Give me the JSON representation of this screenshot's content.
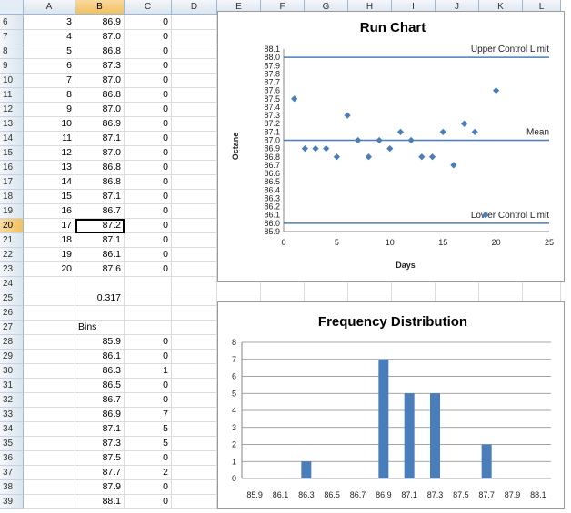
{
  "sheet": {
    "columns": [
      "A",
      "B",
      "C",
      "D",
      "E",
      "F",
      "G",
      "H",
      "I",
      "J",
      "K",
      "L"
    ],
    "selected_column": "B",
    "active_cell": "B20",
    "rows": [
      {
        "row": "6",
        "a": "3",
        "b": "86.9",
        "c": "0"
      },
      {
        "row": "7",
        "a": "4",
        "b": "87.0",
        "c": "0"
      },
      {
        "row": "8",
        "a": "5",
        "b": "86.8",
        "c": "0"
      },
      {
        "row": "9",
        "a": "6",
        "b": "87.3",
        "c": "0"
      },
      {
        "row": "10",
        "a": "7",
        "b": "87.0",
        "c": "0"
      },
      {
        "row": "11",
        "a": "8",
        "b": "86.8",
        "c": "0"
      },
      {
        "row": "12",
        "a": "9",
        "b": "87.0",
        "c": "0"
      },
      {
        "row": "13",
        "a": "10",
        "b": "86.9",
        "c": "0"
      },
      {
        "row": "14",
        "a": "11",
        "b": "87.1",
        "c": "0"
      },
      {
        "row": "15",
        "a": "12",
        "b": "87.0",
        "c": "0"
      },
      {
        "row": "16",
        "a": "13",
        "b": "86.8",
        "c": "0"
      },
      {
        "row": "17",
        "a": "14",
        "b": "86.8",
        "c": "0"
      },
      {
        "row": "18",
        "a": "15",
        "b": "87.1",
        "c": "0"
      },
      {
        "row": "19",
        "a": "16",
        "b": "86.7",
        "c": "0"
      },
      {
        "row": "20",
        "a": "17",
        "b": "87.2",
        "c": "0"
      },
      {
        "row": "21",
        "a": "18",
        "b": "87.1",
        "c": "0"
      },
      {
        "row": "22",
        "a": "19",
        "b": "86.1",
        "c": "0"
      },
      {
        "row": "23",
        "a": "20",
        "b": "87.6",
        "c": "0"
      },
      {
        "row": "24",
        "a": "",
        "b": "",
        "c": ""
      },
      {
        "row": "25",
        "a": "",
        "b": "0.317",
        "c": ""
      },
      {
        "row": "26",
        "a": "",
        "b": "",
        "c": ""
      },
      {
        "row": "27",
        "a": "",
        "b": "Bins",
        "c": ""
      },
      {
        "row": "28",
        "a": "",
        "b": "85.9",
        "c": "0"
      },
      {
        "row": "29",
        "a": "",
        "b": "86.1",
        "c": "0"
      },
      {
        "row": "30",
        "a": "",
        "b": "86.3",
        "c": "1"
      },
      {
        "row": "31",
        "a": "",
        "b": "86.5",
        "c": "0"
      },
      {
        "row": "32",
        "a": "",
        "b": "86.7",
        "c": "0"
      },
      {
        "row": "33",
        "a": "",
        "b": "86.9",
        "c": "7"
      },
      {
        "row": "34",
        "a": "",
        "b": "87.1",
        "c": "5"
      },
      {
        "row": "35",
        "a": "",
        "b": "87.3",
        "c": "5"
      },
      {
        "row": "36",
        "a": "",
        "b": "87.5",
        "c": "0"
      },
      {
        "row": "37",
        "a": "",
        "b": "87.7",
        "c": "2"
      },
      {
        "row": "38",
        "a": "",
        "b": "87.9",
        "c": "0"
      },
      {
        "row": "39",
        "a": "",
        "b": "88.1",
        "c": "0"
      }
    ]
  },
  "colors": {
    "marker": "#4a7ebb",
    "bar": "#4a7ebb",
    "control_line": "#4a7ebb",
    "gridline": "#868686"
  },
  "chart_data": [
    {
      "type": "scatter",
      "title": "Run Chart",
      "xlabel": "Days",
      "ylabel": "Octane",
      "xlim": [
        0,
        25
      ],
      "ylim": [
        85.9,
        88.1
      ],
      "x_ticks": [
        "0",
        "5",
        "10",
        "15",
        "20",
        "25"
      ],
      "y_ticks": [
        "85.9",
        "86.0",
        "86.1",
        "86.2",
        "86.3",
        "86.4",
        "86.5",
        "86.6",
        "86.7",
        "86.8",
        "86.9",
        "87.0",
        "87.1",
        "87.2",
        "87.3",
        "87.4",
        "87.5",
        "87.6",
        "87.7",
        "87.8",
        "87.9",
        "88.0",
        "88.1"
      ],
      "x": [
        1,
        2,
        3,
        4,
        5,
        6,
        7,
        8,
        9,
        10,
        11,
        12,
        13,
        14,
        15,
        16,
        17,
        18,
        19,
        20
      ],
      "y": [
        87.5,
        86.9,
        86.9,
        86.9,
        86.8,
        87.3,
        87.0,
        86.8,
        87.0,
        86.9,
        87.1,
        87.0,
        86.8,
        86.8,
        87.1,
        86.7,
        87.2,
        87.1,
        86.1,
        87.6
      ],
      "reference_lines": [
        {
          "label": "Upper Control Limit",
          "value": 88.0
        },
        {
          "label": "Mean",
          "value": 87.0
        },
        {
          "label": "Lower Control Limit",
          "value": 86.0
        }
      ]
    },
    {
      "type": "bar",
      "title": "Frequency Distribution",
      "categories": [
        "85.9",
        "86.1",
        "86.3",
        "86.5",
        "86.7",
        "86.9",
        "87.1",
        "87.3",
        "87.5",
        "87.7",
        "87.9",
        "88.1"
      ],
      "values": [
        0,
        0,
        1,
        0,
        0,
        7,
        5,
        5,
        0,
        2,
        0,
        0
      ],
      "ylim": [
        0,
        8
      ],
      "y_ticks": [
        "0",
        "1",
        "2",
        "3",
        "4",
        "5",
        "6",
        "7",
        "8"
      ],
      "grid": true
    }
  ]
}
